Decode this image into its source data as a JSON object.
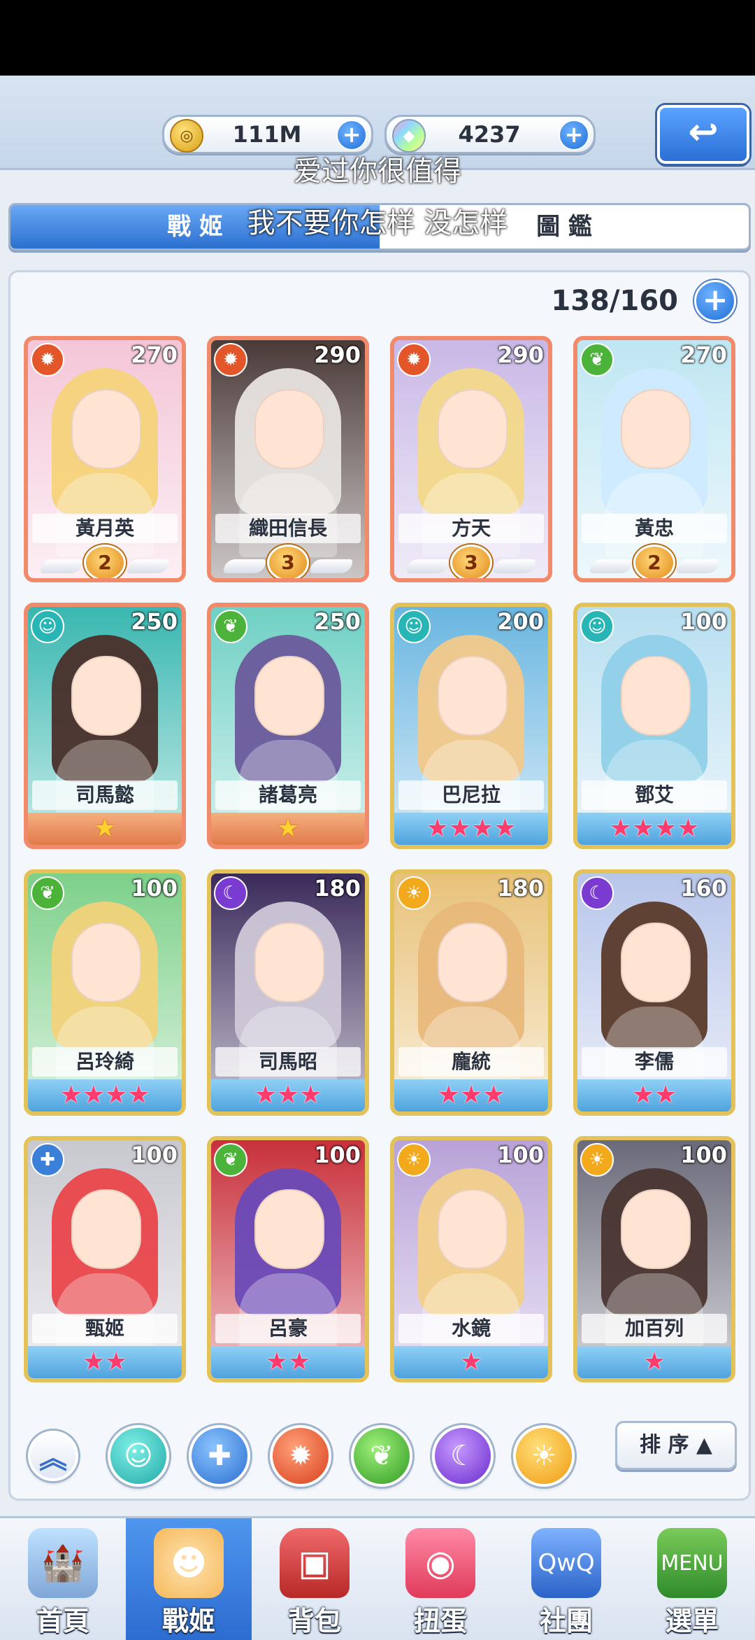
{
  "currency": {
    "gold_value": "111M",
    "gems_value": "4237",
    "gold_icon": "coin-icon",
    "gems_icon": "crystal-icon"
  },
  "lyrics": {
    "line1": "爱过你很值得",
    "line2": "我不要你怎样 没怎样"
  },
  "tabs": {
    "active": "戰 姬",
    "inactive": "圖 鑑"
  },
  "collection": {
    "count": "138/160"
  },
  "cards": [
    {
      "name": "黃月英",
      "power": "270",
      "element": "fire",
      "frame": "red",
      "rank": "2"
    },
    {
      "name": "織田信長",
      "power": "290",
      "element": "fire",
      "frame": "red",
      "rank": "3"
    },
    {
      "name": "方天",
      "power": "290",
      "element": "fire",
      "frame": "red",
      "rank": "3"
    },
    {
      "name": "黃忠",
      "power": "270",
      "element": "wood",
      "frame": "red",
      "rank": "2"
    },
    {
      "name": "司馬懿",
      "power": "250",
      "element": "water",
      "frame": "red",
      "stars": "★"
    },
    {
      "name": "諸葛亮",
      "power": "250",
      "element": "wood",
      "frame": "red",
      "stars": "★"
    },
    {
      "name": "巴尼拉",
      "power": "200",
      "element": "water",
      "frame": "gold",
      "stars": "★★★★"
    },
    {
      "name": "鄧艾",
      "power": "100",
      "element": "water",
      "frame": "gold",
      "stars": "★★★★"
    },
    {
      "name": "呂玲綺",
      "power": "100",
      "element": "wood",
      "frame": "gold",
      "stars": "★★★★"
    },
    {
      "name": "司馬昭",
      "power": "180",
      "element": "dark",
      "frame": "gold",
      "stars": "★★★"
    },
    {
      "name": "龐統",
      "power": "180",
      "element": "light",
      "frame": "gold",
      "stars": "★★★"
    },
    {
      "name": "李儒",
      "power": "160",
      "element": "dark",
      "frame": "gold",
      "stars": "★★"
    },
    {
      "name": "甄姬",
      "power": "100",
      "element": "heal",
      "frame": "gold",
      "stars": "★★"
    },
    {
      "name": "呂豪",
      "power": "100",
      "element": "wood",
      "frame": "gold",
      "stars": "★★"
    },
    {
      "name": "水鏡",
      "power": "100",
      "element": "light",
      "frame": "gold",
      "stars": "★"
    },
    {
      "name": "加百列",
      "power": "100",
      "element": "light",
      "frame": "gold",
      "stars": "★"
    }
  ],
  "filters": {
    "sort_label": "排 序 ▲",
    "buttons": [
      "collapse-up-icon",
      "water-element-icon",
      "heal-element-icon",
      "fire-element-icon",
      "wood-element-icon",
      "dark-element-icon",
      "light-element-icon"
    ]
  },
  "nav": [
    {
      "label": "首頁",
      "icon": "castle-icon"
    },
    {
      "label": "戰姬",
      "icon": "heroine-icon",
      "active": true
    },
    {
      "label": "背包",
      "icon": "backpack-icon"
    },
    {
      "label": "扭蛋",
      "icon": "gacha-machine-icon"
    },
    {
      "label": "社團",
      "icon": "guild-sign-icon"
    },
    {
      "label": "選單",
      "icon": "menu-book-icon"
    }
  ],
  "colors": {
    "accent_blue": "#2c70d0",
    "fire": "#e2562a",
    "water": "#28b5b5",
    "wood": "#4cb33a",
    "dark": "#7a3bd1",
    "light": "#f2a91c",
    "heal": "#3a7fd8"
  }
}
